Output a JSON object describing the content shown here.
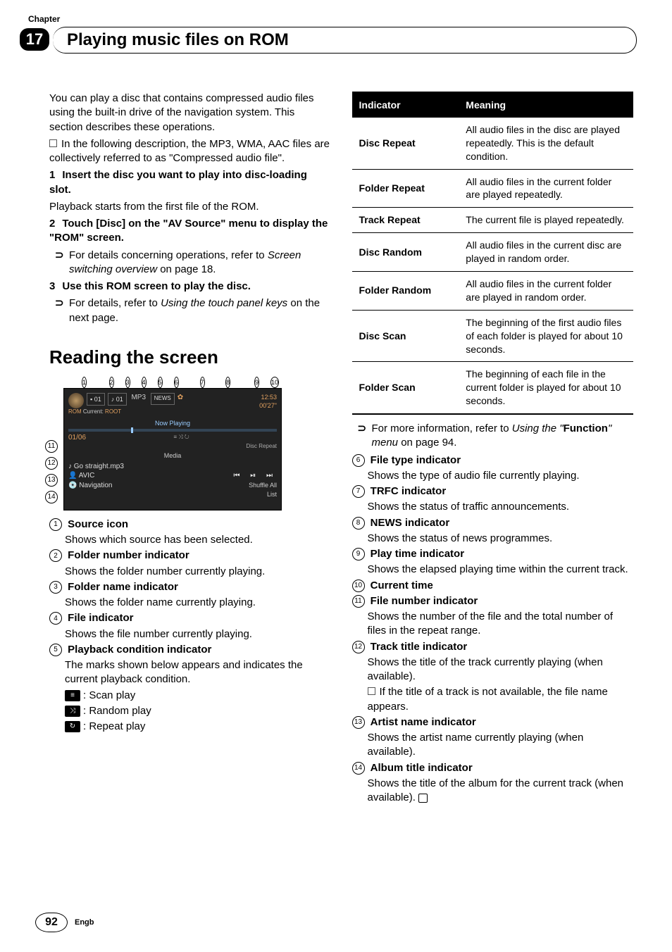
{
  "chapter_label": "Chapter",
  "chapter_number": "17",
  "chapter_title": "Playing music files on ROM",
  "left": {
    "intro": "You can play a disc that contains compressed audio files using the built-in drive of the navigation system. This section describes these operations.",
    "intro_note": "In the following description, the MP3, WMA, AAC files are collectively referred to as \"Compressed audio file\".",
    "step1_num": "1",
    "step1_title": "Insert the disc you want to play into disc-loading slot.",
    "step1_desc": "Playback starts from the first file of the ROM.",
    "step2_num": "2",
    "step2_title": "Touch [Disc] on the \"AV Source\" menu to display the \"ROM\" screen.",
    "step2_sub": "For details concerning operations, refer to ",
    "step2_sub_em": "Screen switching overview",
    "step2_sub_tail": " on page 18.",
    "step3_num": "3",
    "step3_title": "Use this ROM screen to play the disc.",
    "step3_sub": "For details, refer to ",
    "step3_sub_em": "Using the touch panel keys",
    "step3_sub_tail": " on the next page.",
    "h2": "Reading the screen",
    "screenshot": {
      "folder_block": "01",
      "file_block": "01",
      "filetype": "MP3",
      "rom_label": "ROM",
      "current_label": "Current:",
      "root_label": "ROOT",
      "now_playing": "Now Playing",
      "track_pos": "01/06",
      "disc_repeat": "Disc Repeat",
      "media": "Media",
      "track_title": "Go straight.mp3",
      "artist": "AVIC",
      "album": "Navigation",
      "shuffle": "Shuffle All",
      "list": "List",
      "time_top": "12:53",
      "time_bottom": "00'27\"",
      "news": "NEWS"
    },
    "indicators": [
      {
        "n": "1",
        "t": "Source icon",
        "d": "Shows which source has been selected."
      },
      {
        "n": "2",
        "t": "Folder number indicator",
        "d": "Shows the folder number currently playing."
      },
      {
        "n": "3",
        "t": "Folder name indicator",
        "d": "Shows the folder name currently playing."
      },
      {
        "n": "4",
        "t": "File indicator",
        "d": "Shows the file number currently playing."
      },
      {
        "n": "5",
        "t": "Playback condition indicator",
        "d": "The marks shown below appears and indicates the current playback condition."
      }
    ],
    "scan": ": Scan play",
    "random": ": Random play",
    "repeat": ": Repeat play"
  },
  "right": {
    "table_header_1": "Indicator",
    "table_header_2": "Meaning",
    "rows": [
      {
        "k": "Disc Repeat",
        "v": "All audio files in the disc are played repeatedly. This is the default condition."
      },
      {
        "k": "Folder Repeat",
        "v": "All audio files in the current folder are played repeatedly."
      },
      {
        "k": "Track Repeat",
        "v": "The current file is played repeatedly."
      },
      {
        "k": "Disc Random",
        "v": "All audio files in the current disc are played in random order."
      },
      {
        "k": "Folder Random",
        "v": "All audio files in the current folder are played in random order."
      },
      {
        "k": "Disc Scan",
        "v": "The beginning of the first audio files of each folder is played for about 10 seconds."
      },
      {
        "k": "Folder Scan",
        "v": "The beginning of each file in the current folder is played for about 10 seconds."
      }
    ],
    "ref_lead": "For more information, refer to ",
    "ref_em1": "Using the \"",
    "ref_bold": "Function",
    "ref_em2": "\" menu",
    "ref_tail": " on page 94.",
    "indicators": [
      {
        "n": "6",
        "t": "File type indicator",
        "d": "Shows the type of audio file currently playing."
      },
      {
        "n": "7",
        "t": "TRFC indicator",
        "d": "Shows the status of traffic announcements."
      },
      {
        "n": "8",
        "t": "NEWS indicator",
        "d": "Shows the status of news programmes."
      },
      {
        "n": "9",
        "t": "Play time indicator",
        "d": "Shows the elapsed playing time within the current track."
      },
      {
        "n": "a",
        "display": "10",
        "t": "Current time",
        "d": ""
      },
      {
        "n": "b",
        "display": "11",
        "t": "File number indicator",
        "d": "Shows the number of the file and the total number of files in the repeat range."
      },
      {
        "n": "c",
        "display": "12",
        "t": "Track title indicator",
        "d": "Shows the title of the track currently playing (when available)."
      },
      {
        "n": "c2",
        "display": "",
        "t": "",
        "d_note": "If the title of a track is not available, the file name appears."
      },
      {
        "n": "d",
        "display": "13",
        "t": "Artist name indicator",
        "d": "Shows the artist name currently playing (when available)."
      },
      {
        "n": "e",
        "display": "14",
        "t": "Album title indicator",
        "d": "Shows the title of the album for the current track (when available)."
      }
    ]
  },
  "footer": {
    "page": "92",
    "lang": "Engb"
  }
}
